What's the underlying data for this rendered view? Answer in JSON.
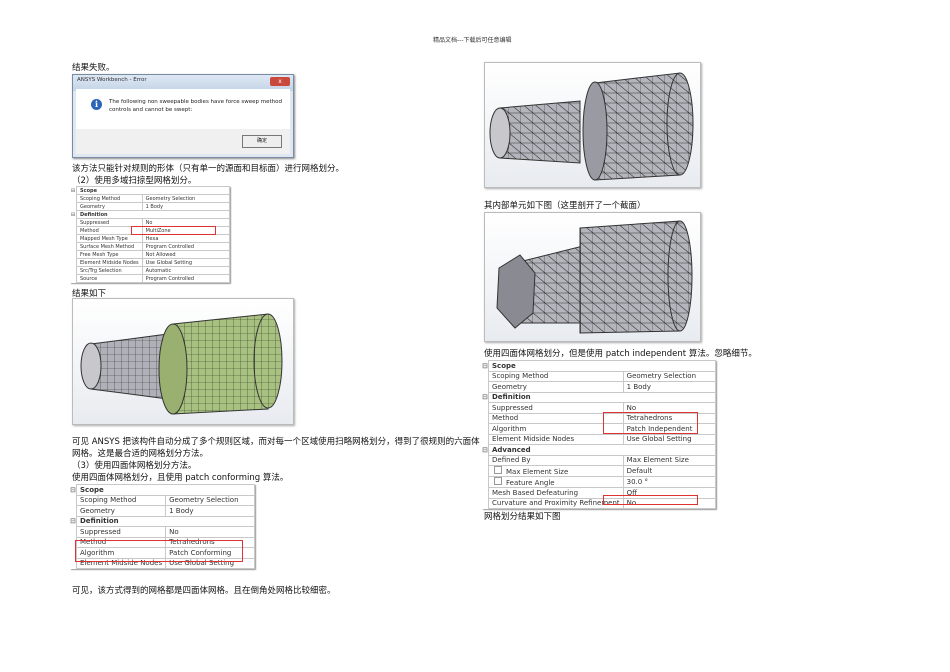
{
  "header": "精品文档---下载后可任意编辑",
  "left": {
    "p1": "结果失败。",
    "dialog": {
      "title": "ANSYS Workbench - Error",
      "close": "x",
      "message_line1": "The following non sweepable bodies have force sweep method",
      "message_line2": "controls and cannot be swept:",
      "ok": "确定"
    },
    "p2": "该方法只能针对规则的形体（只有单一的源面和目标面）进行网格划分。",
    "p3": "（2）使用多域扫掠型网格划分。",
    "table1": [
      {
        "h": "Scope"
      },
      {
        "k": "Scoping Method",
        "v": "Geometry Selection"
      },
      {
        "k": "Geometry",
        "v": "1 Body"
      },
      {
        "h": "Definition"
      },
      {
        "k": "Suppressed",
        "v": "No"
      },
      {
        "k": "Method",
        "v": "MultiZone"
      },
      {
        "k": "Mapped Mesh Type",
        "v": "Hexa"
      },
      {
        "k": "Surface Mesh Method",
        "v": "Program Controlled"
      },
      {
        "k": "Free Mesh Type",
        "v": "Not Allowed"
      },
      {
        "k": "Element Midside Nodes",
        "v": "Use Global Setting"
      },
      {
        "k": "Src/Trg Selection",
        "v": "Automatic"
      },
      {
        "k": "Source",
        "v": "Program Controlled"
      }
    ],
    "p4": "结果如下",
    "p5a": "可见 ANSYS 把该构件自动分成了多个规则区域，而对每一个区域使用扫略网格划分，得到了很规则的六面体",
    "p5b": "网格。这是最合适的网格划分方法。",
    "p6": "（3）使用四面体网格划分方法。",
    "p7": "使用四面体网格划分，且使用 patch conforming 算法。",
    "table2": [
      {
        "h": "Scope"
      },
      {
        "k": "Scoping Method",
        "v": "Geometry Selection"
      },
      {
        "k": "Geometry",
        "v": "1 Body"
      },
      {
        "h": "Definition"
      },
      {
        "k": "Suppressed",
        "v": "No"
      },
      {
        "k": "Method",
        "v": "Tetrahedrons"
      },
      {
        "k": "Algorithm",
        "v": "Patch Conforming"
      },
      {
        "k": "Element Midside Nodes",
        "v": "Use Global Setting"
      }
    ],
    "p8": "可见，该方式得到的网格都是四面体网格。且在倒角处网格比较细密。"
  },
  "right": {
    "p1": "其内部单元如下图（这里剖开了一个截面）",
    "p2": "使用四面体网格划分，但是使用 patch independent 算法。忽略细节。",
    "table3": [
      {
        "h": "Scope"
      },
      {
        "k": "Scoping Method",
        "v": "Geometry Selection"
      },
      {
        "k": "Geometry",
        "v": "1 Body"
      },
      {
        "h": "Definition"
      },
      {
        "k": "Suppressed",
        "v": "No"
      },
      {
        "k": "Method",
        "v": "Tetrahedrons"
      },
      {
        "k": "Algorithm",
        "v": "Patch Independent"
      },
      {
        "k": "Element Midside Nodes",
        "v": "Use Global Setting"
      },
      {
        "h": "Advanced"
      },
      {
        "k": "Defined By",
        "v": "Max Element Size"
      },
      {
        "k": "Max Element Size",
        "v": "Default",
        "cb": true
      },
      {
        "k": "Feature Angle",
        "v": "30.0 °",
        "cb": true
      },
      {
        "k": "Mesh Based Defeaturing",
        "v": "Off"
      },
      {
        "k": "Curvature and Proximity Refinement",
        "v": "No"
      }
    ],
    "p3": "网格划分结果如下图"
  }
}
